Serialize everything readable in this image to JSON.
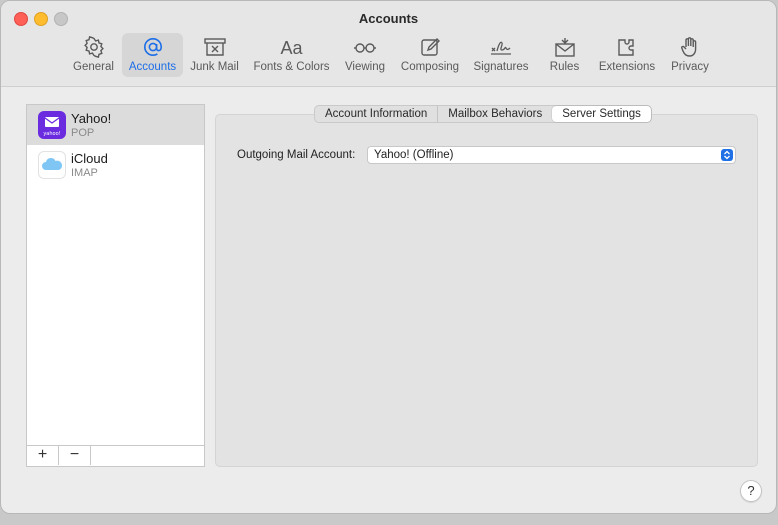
{
  "window": {
    "title": "Accounts"
  },
  "toolbar": {
    "items": [
      {
        "label": "General",
        "icon": "gear-icon"
      },
      {
        "label": "Accounts",
        "icon": "at-sign-icon",
        "active": true
      },
      {
        "label": "Junk Mail",
        "icon": "junk-mail-icon"
      },
      {
        "label": "Fonts & Colors",
        "icon": "fonts-icon",
        "glyph": "Aa"
      },
      {
        "label": "Viewing",
        "icon": "glasses-icon"
      },
      {
        "label": "Composing",
        "icon": "compose-icon"
      },
      {
        "label": "Signatures",
        "icon": "signature-icon"
      },
      {
        "label": "Rules",
        "icon": "rules-envelope-icon"
      },
      {
        "label": "Extensions",
        "icon": "puzzle-icon"
      },
      {
        "label": "Privacy",
        "icon": "hand-icon"
      }
    ],
    "accent": "#1d6ee8"
  },
  "accounts": [
    {
      "name": "Yahoo!",
      "type": "POP",
      "icon": "yahoo-mail-icon",
      "selected": true,
      "icon_text": "yahoo!"
    },
    {
      "name": "iCloud",
      "type": "IMAP",
      "icon": "icloud-icon",
      "selected": false
    }
  ],
  "list_footer": {
    "add": "+",
    "remove": "−"
  },
  "tabs": [
    {
      "label": "Account Information"
    },
    {
      "label": "Mailbox Behaviors"
    },
    {
      "label": "Server Settings",
      "active": true
    }
  ],
  "server_settings": {
    "outgoing_label": "Outgoing Mail Account:",
    "outgoing_value": "Yahoo! (Offline)"
  },
  "help": {
    "label": "?"
  }
}
